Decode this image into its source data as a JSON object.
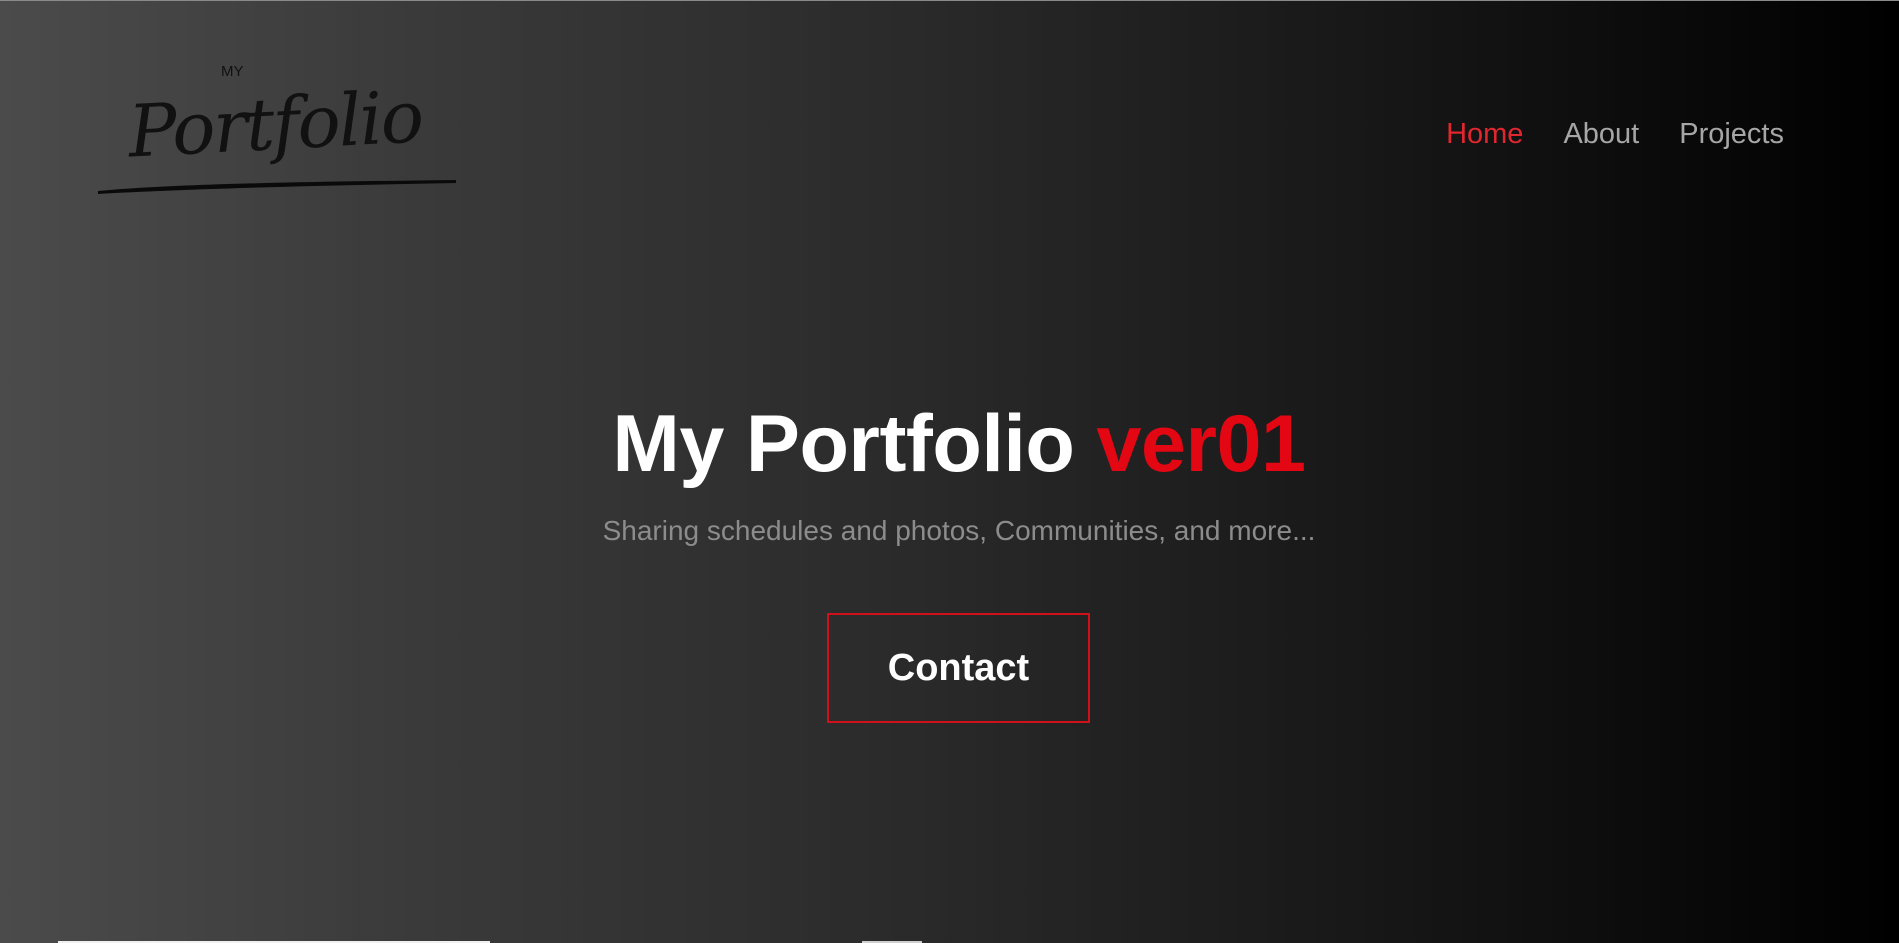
{
  "logo": {
    "small_text": "MY",
    "script_text": "Portfolio"
  },
  "nav": {
    "items": [
      {
        "label": "Home",
        "active": true
      },
      {
        "label": "About",
        "active": false
      },
      {
        "label": "Projects",
        "active": false
      }
    ]
  },
  "hero": {
    "title_main": "My Portfolio",
    "title_accent": "ver01",
    "subtitle": "Sharing schedules and photos, Communities, and more...",
    "cta_label": "Contact"
  },
  "colors": {
    "accent": "#e30613",
    "nav_active": "#e0262e",
    "nav_inactive": "#a6a6a6",
    "subtitle": "#8c8c8c"
  }
}
